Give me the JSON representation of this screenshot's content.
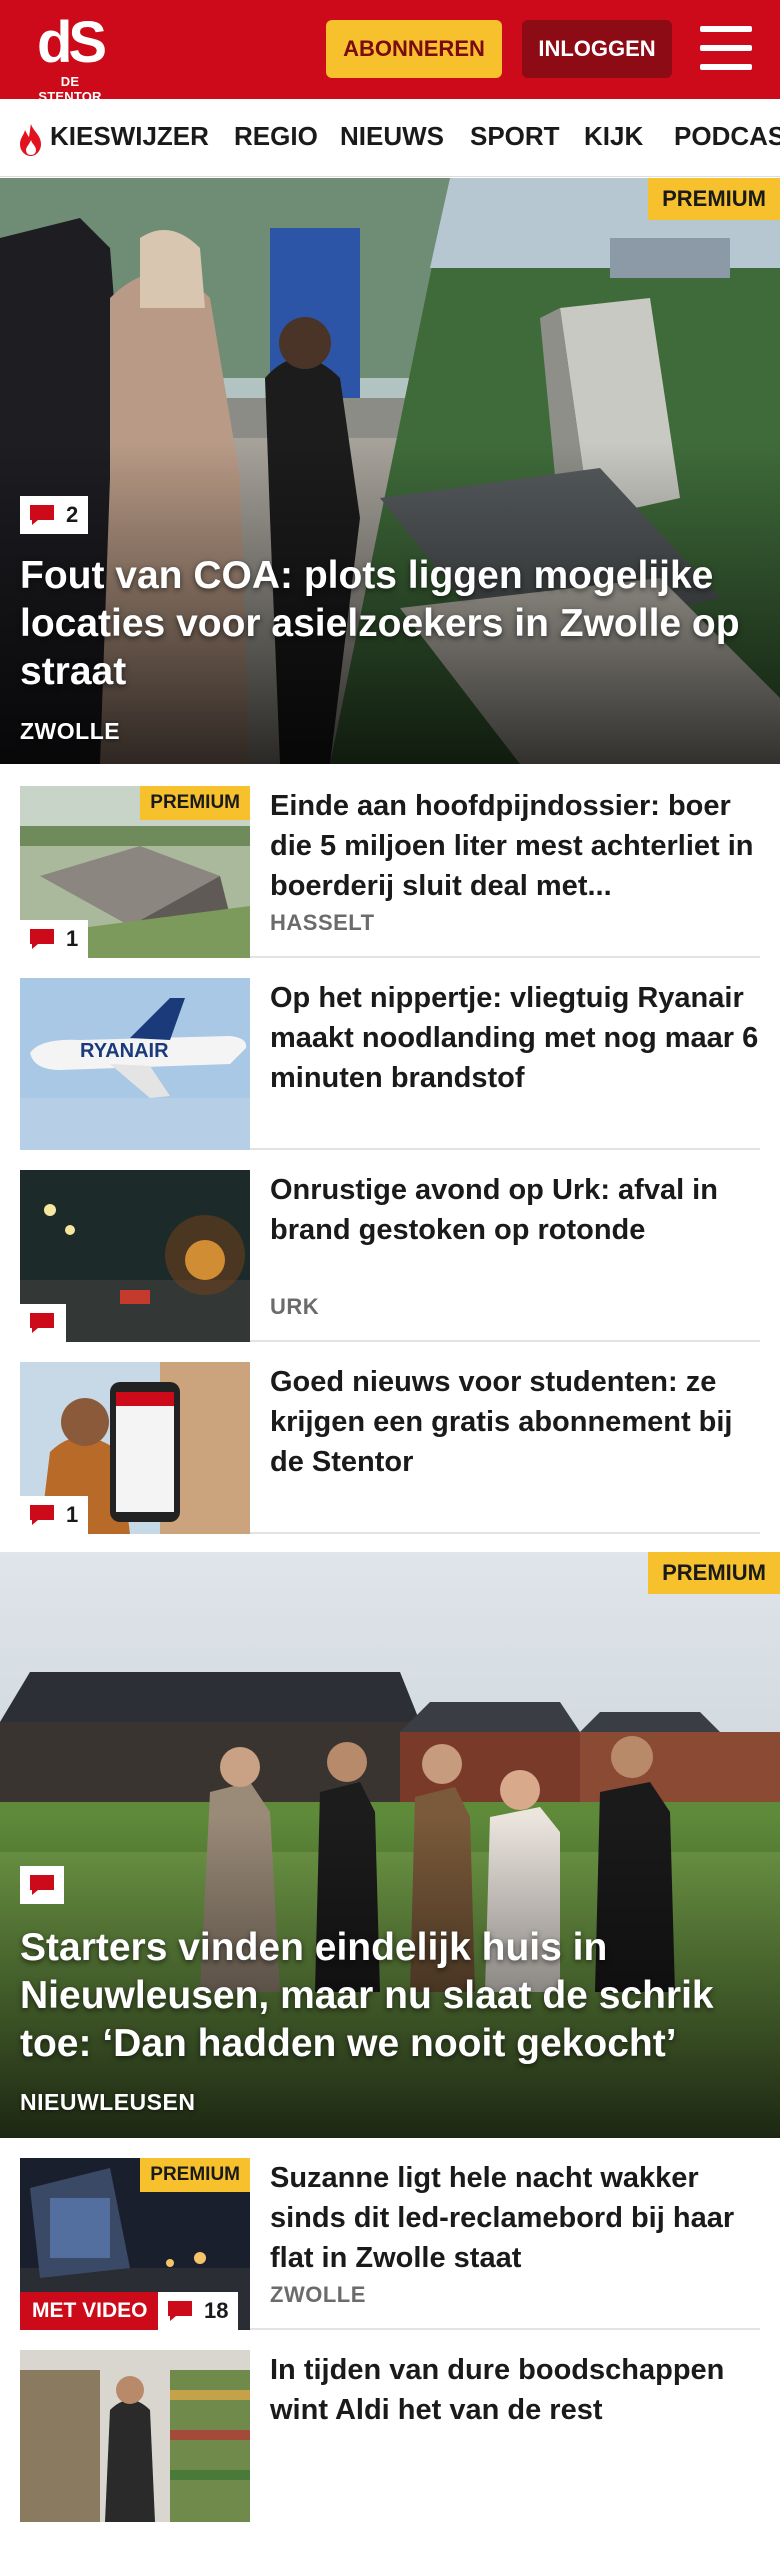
{
  "header": {
    "logo_mark": "dS",
    "logo_sub": "DE STENTOR",
    "subscribe_label": "ABONNEREN",
    "login_label": "INLOGGEN",
    "brand_color": "#cc0a19",
    "accent_color": "#f7c12e"
  },
  "nav": {
    "items": [
      {
        "label": "KIESWIJZER",
        "icon": "flame-icon"
      },
      {
        "label": "REGIO"
      },
      {
        "label": "NIEUWS"
      },
      {
        "label": "SPORT"
      },
      {
        "label": "KIJK"
      },
      {
        "label": "PODCAST"
      }
    ]
  },
  "hero1": {
    "badge": "PREMIUM",
    "comments": "2",
    "title": "Fout van COA: plots liggen mogelijke locaties voor asielzoekers in Zwolle op straat",
    "place": "ZWOLLE"
  },
  "articles": [
    {
      "badge": "PREMIUM",
      "comments": "1",
      "title": "Einde aan hoofdpijndossier: boer die 5 miljoen liter mest achterliet in boerderij sluit deal met...",
      "place": "HASSELT"
    },
    {
      "title": "Op het nippertje: vliegtuig Ryanair maakt noodlanding met nog maar 6 minuten brandstof",
      "airline_text": "RYANAIR"
    },
    {
      "title": "Onrustige avond op Urk: afval in brand gestoken op rotonde",
      "place": "URK"
    },
    {
      "comments": "1",
      "title": "Goed nieuws voor studenten: ze krijgen een gratis abonnement bij de Stentor"
    }
  ],
  "hero2": {
    "badge": "PREMIUM",
    "title": "Starters vinden eindelijk huis in Nieuwleusen, maar nu slaat de schrik toe: ‘Dan hadden we nooit gekocht’",
    "place": "NIEUWLEUSEN"
  },
  "articles2": [
    {
      "badge": "PREMIUM",
      "video_label": "MET VIDEO",
      "comments": "18",
      "title": "Suzanne ligt hele nacht wakker sinds dit led-reclamebord bij haar flat in Zwolle staat",
      "place": "ZWOLLE"
    },
    {
      "title": "In tijden van dure boodschappen wint Aldi het van de rest"
    }
  ]
}
